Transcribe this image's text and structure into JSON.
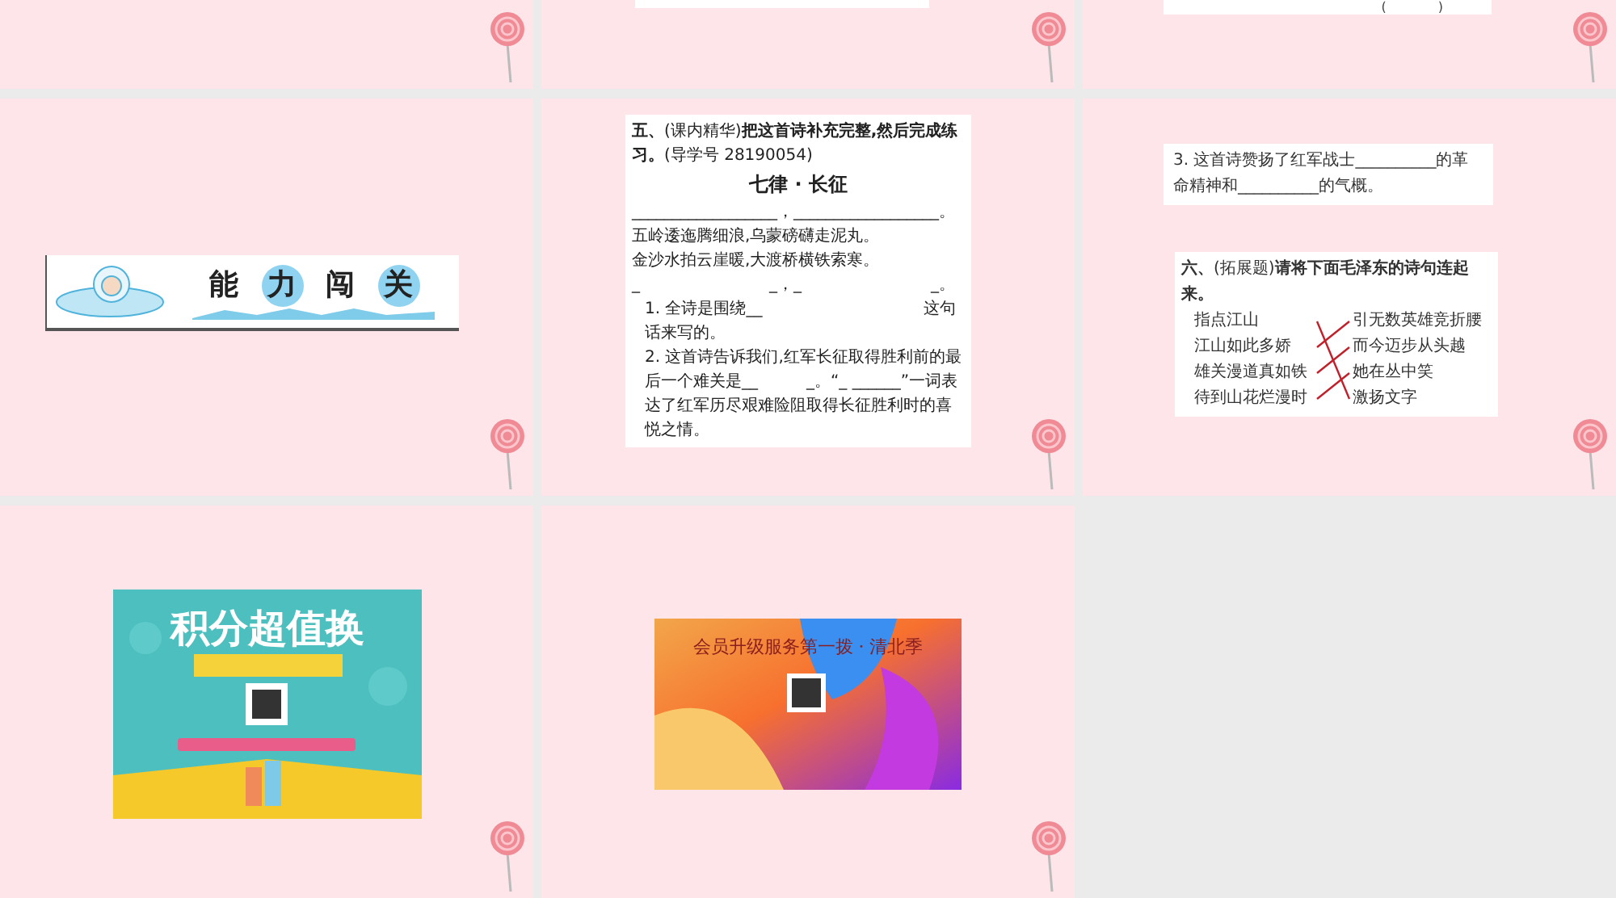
{
  "slides": [
    {
      "kind": "blank"
    },
    {
      "kind": "cut_card"
    },
    {
      "kind": "cut_card_paren",
      "text": "(　　　　)"
    },
    {
      "kind": "banner",
      "chars": [
        {
          "text": "能",
          "circled": false
        },
        {
          "text": "力",
          "circled": true
        },
        {
          "text": "闯",
          "circled": false
        },
        {
          "text": "关",
          "circled": true
        }
      ]
    },
    {
      "kind": "poem",
      "heading": "**五、**(课内精华)**把这首诗补充完整,然后完成练习。**(导学号 28190054)",
      "title": "七律 · 长征",
      "lines": [
        "__________________，__________________。",
        "五岭逶迤腾细浪,乌蒙磅礴走泥丸。",
        "金沙水拍云崖暖,大渡桥横铁索寒。",
        "_　　　　　　　　_，_　　　　　　　　_。"
      ],
      "questions": [
        "1. 全诗是围绕__　　　　　　　　　　这句话来写的。",
        "2. 这首诗告诉我们,红军长征取得胜利前的最后一个难关是__　　　_。“_ ______”一词表达了红军历尽艰难险阻取得长征胜利时的喜悦之情。"
      ]
    },
    {
      "kind": "matching",
      "question": "3. 这首诗赞扬了红军战士__________的革命精神和__________的气概。",
      "heading": "**六、**(拓展题)**请将下面毛泽东的诗句连起来。**",
      "left": [
        {
          "text": "指点江山",
          "kind": "down3"
        },
        {
          "text": "江山如此多娇",
          "kind": "up1"
        },
        {
          "text": "雄关漫道真如铁",
          "kind": "up1"
        },
        {
          "text": "待到山花烂漫时",
          "kind": "up1"
        }
      ],
      "right": [
        "引无数英雄竞折腰",
        "而今迈步从头越",
        "她在丛中笑",
        "激扬文字"
      ]
    },
    {
      "kind": "poster_points",
      "title": "积分超值换"
    },
    {
      "kind": "poster_member",
      "title": "会员升级服务第一拨 · 清北季"
    }
  ]
}
